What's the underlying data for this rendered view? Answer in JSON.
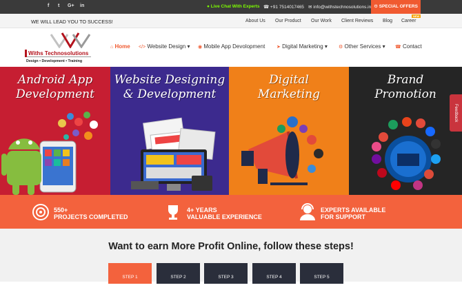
{
  "topbar": {
    "social": [
      "f",
      "t",
      "G+",
      "in"
    ],
    "live_chat": "Live Chat With Experts",
    "phone": "+91 7514017465",
    "email": "info@withstechnosolutions.in",
    "offers": "SPECIAL OFFERS"
  },
  "secbar": {
    "tagline": "WE WILL LEAD YOU TO SUCCESS!",
    "links": [
      "About Us",
      "Our Product",
      "Our Work",
      "Client Reviews",
      "Blog",
      "Career"
    ],
    "new_badge": "NEW"
  },
  "logo": {
    "name": "Withs Technosolutions",
    "sub": "Design  •  Development  •  Training"
  },
  "nav": {
    "home": "Home",
    "website_design": "Website Design",
    "mobile_app": "Mobile App Devolopment",
    "digital_marketing": "Digital Marketing",
    "other_services": "Other Services",
    "contact": "Contact"
  },
  "banners": [
    {
      "title1": "Android App",
      "title2": "Development",
      "color": "#c61e32"
    },
    {
      "title1": "Website Designing",
      "title2": "& Development",
      "color": "#3c2a8e"
    },
    {
      "title1": "Digital",
      "title2": "Marketing",
      "color": "#f08019"
    },
    {
      "title1": "Brand",
      "title2": "Promotion",
      "color": "#252525"
    }
  ],
  "stats": [
    {
      "line1": "550+",
      "line2": "PROJECTS COMPLETED",
      "icon": "target-icon"
    },
    {
      "line1": "4+ YEARS",
      "line2": "VALUABLE EXPERIENCE",
      "icon": "trophy-icon"
    },
    {
      "line1": "EXPERTS AVAILABLE",
      "line2": "FOR SUPPORT",
      "icon": "support-agent-icon"
    }
  ],
  "steps": {
    "title": "Want to earn More Profit Online, follow these steps!",
    "items": [
      "STEP 1",
      "STEP 2",
      "STEP 3",
      "STEP 4",
      "STEP 5"
    ]
  },
  "feedback": "Feedback",
  "colors": {
    "accent": "#f3623d",
    "topbar": "#3a3a3a",
    "live": "#7CFC00"
  }
}
